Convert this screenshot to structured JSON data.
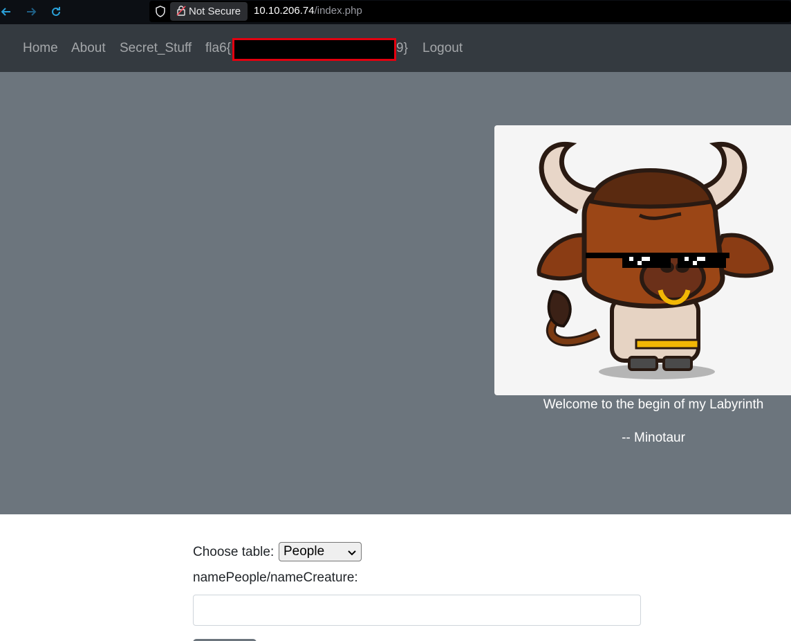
{
  "browser": {
    "security_label": "Not Secure",
    "url_host": "10.10.206.74",
    "url_path": "/index.php"
  },
  "navbar": {
    "links": [
      {
        "label": "Home"
      },
      {
        "label": "About"
      },
      {
        "label": "Secret_Stuff"
      },
      {
        "label": "fla6{",
        "suffix": "9}"
      },
      {
        "label": "Logout"
      }
    ],
    "redaction_color": "#e3000f"
  },
  "hero": {
    "image_icon": "minotaur-cartoon-icon",
    "welcome_text": "Welcome to the begin of my Labyrinth",
    "signature": "-- Minotaur",
    "background": "#6c757d"
  },
  "form": {
    "choose_label": "Choose table:",
    "selected_table": "People",
    "name_label": "namePeople/nameCreature:",
    "name_value": "",
    "name_placeholder": ""
  }
}
